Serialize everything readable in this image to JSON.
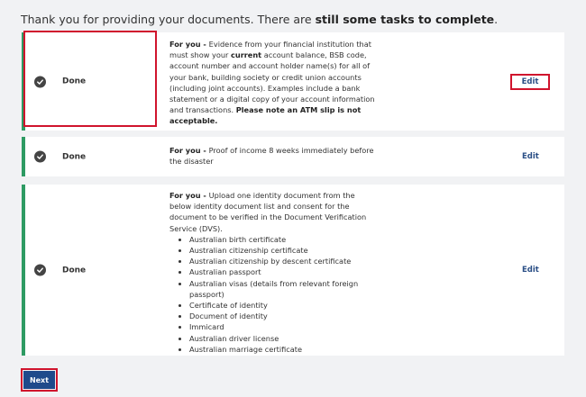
{
  "intro": {
    "text": "Thank you for providing your documents. There are ",
    "bold": "still some tasks to complete",
    "end": "."
  },
  "cards": [
    {
      "status": "Done",
      "lead": "For you - ",
      "desc1": "Evidence from your financial institution that must show your ",
      "desc_bold": "current",
      "desc2": " account balance, BSB code, account number and account holder name(s) for all of your bank, building society or credit union accounts (including joint accounts). Examples include a bank statement or a digital copy of your account information and transactions. ",
      "desc_bold2": "Please note an ATM slip is not acceptable.",
      "edit": "Edit"
    },
    {
      "status": "Done",
      "lead": "For you - ",
      "desc1": "Proof of income 8 weeks immediately before the disaster",
      "edit": "Edit"
    },
    {
      "status": "Done",
      "lead": "For you - ",
      "desc1": "Upload one identity document from the below identity document list and consent for the document to be verified in the Document Verification Service (DVS).",
      "list": [
        "Australian birth certificate",
        "Australian citizenship certificate",
        "Australian citizenship by descent certificate",
        "Australian passport",
        "Australian visas (details from relevant foreign passport)",
        "Certificate of identity",
        "Document of identity",
        "Immicard",
        "Australian driver license",
        "Australian marriage certificate"
      ],
      "edit": "Edit"
    }
  ],
  "next_label": "Next",
  "icons": {
    "status": "check-circle-icon"
  },
  "colors": {
    "accent_bar": "#2e9b63",
    "link": "#2b4f86",
    "button": "#1f4a8b",
    "highlight": "#d0142d"
  }
}
